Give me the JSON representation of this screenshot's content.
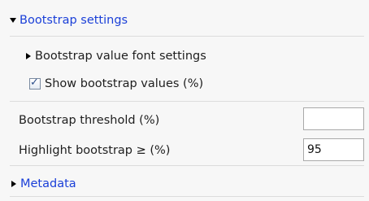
{
  "bootstrap_section": {
    "title": "Bootstrap settings",
    "font_settings_label": "Bootstrap value font settings",
    "show_values_label": "Show bootstrap values (%)",
    "show_values_checked": true,
    "threshold_label": "Bootstrap threshold (%)",
    "threshold_value": "",
    "highlight_label": "Highlight bootstrap ≥ (%)",
    "highlight_value": "95"
  },
  "metadata_section": {
    "title": "Metadata"
  },
  "icons": {
    "expanded": "triangle-down-icon",
    "collapsed": "triangle-right-icon",
    "check": "checkmark-icon"
  },
  "colors": {
    "link": "#1a3fd8",
    "background": "#f7f7f7"
  }
}
